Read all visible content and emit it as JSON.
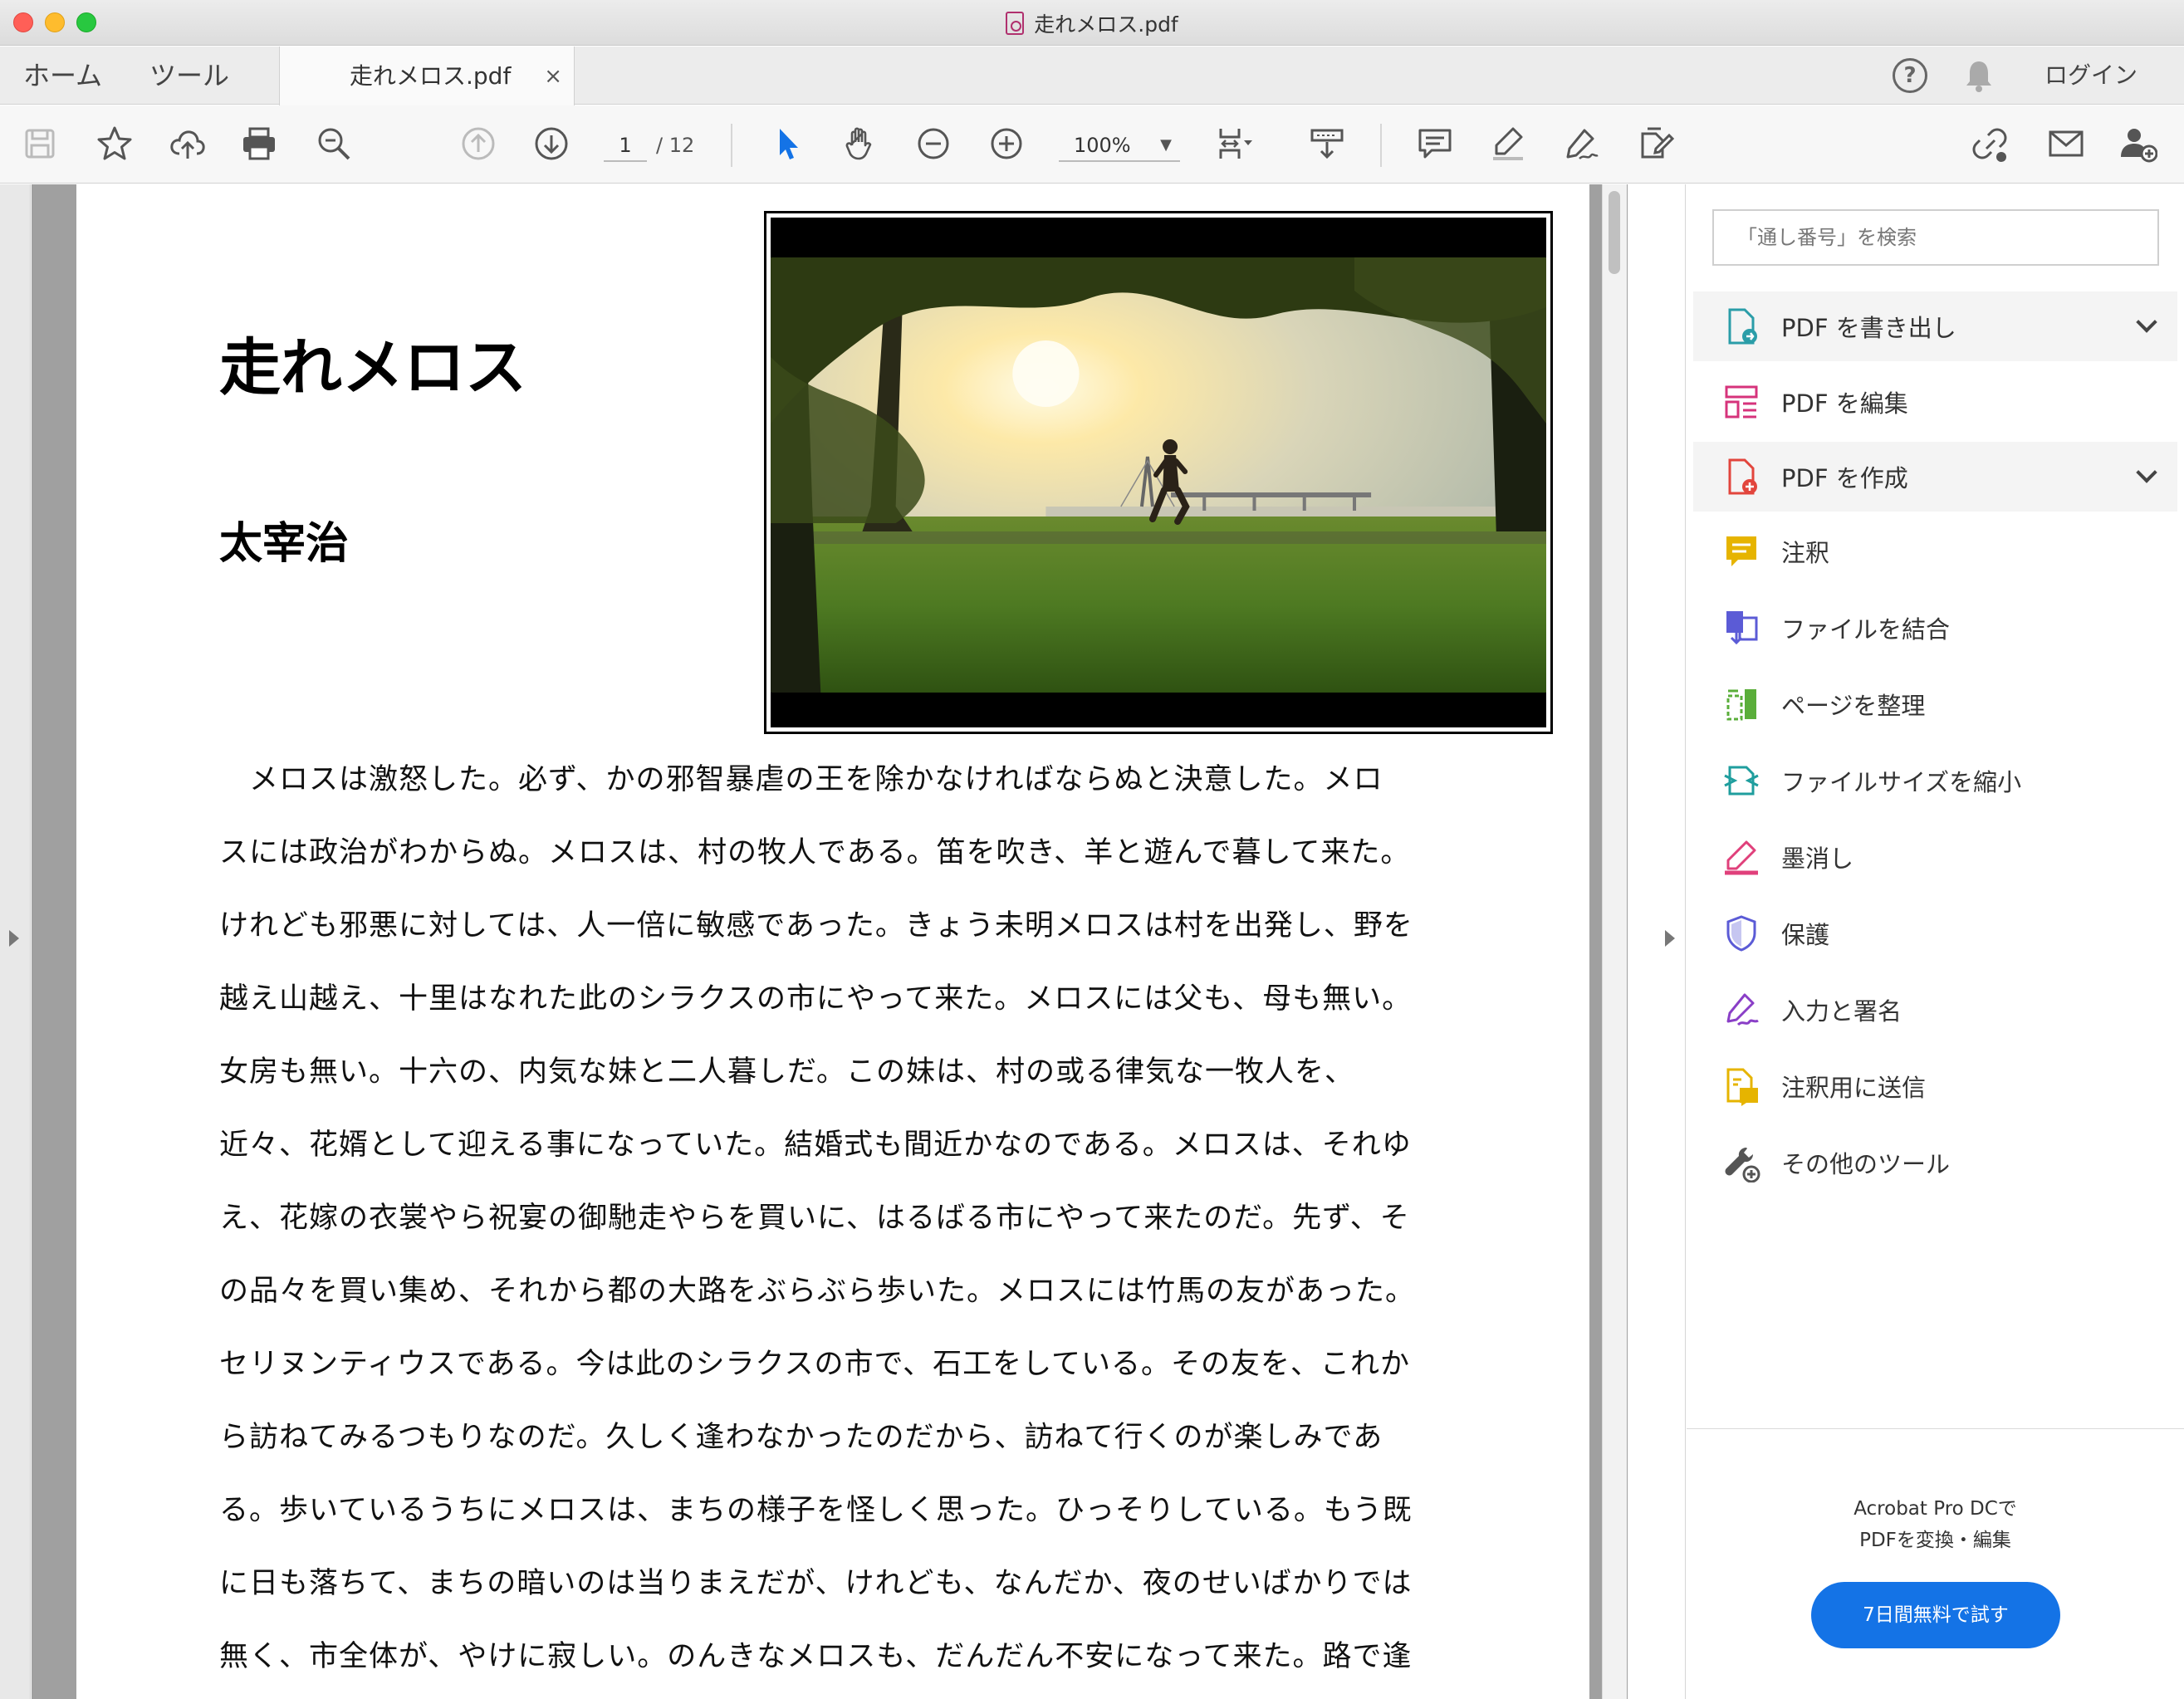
{
  "window": {
    "title": "走れメロス.pdf"
  },
  "tabs": {
    "home": "ホーム",
    "tools": "ツール",
    "document": "走れメロス.pdf",
    "close": "×"
  },
  "header": {
    "help": "?",
    "login": "ログイン"
  },
  "toolbar": {
    "current_page": "1",
    "total_pages": "/ 12",
    "zoom": "100%",
    "zoom_caret": "▼"
  },
  "document": {
    "title": "走れメロス",
    "author": "太宰治",
    "lines": [
      "　メロスは激怒した。必ず、かの邪智暴虐の王を除かなければならぬと決意した。メロ",
      "スには政治がわからぬ。メロスは、村の牧人である。笛を吹き、羊と遊んで暮して来た。",
      "けれども邪悪に対しては、人一倍に敏感であった。きょう未明メロスは村を出発し、野を",
      "越え山越え、十里はなれた此のシラクスの市にやって来た。メロスには父も、母も無い。",
      "女房も無い。十六の、内気な妹と二人暮しだ。この妹は、村の或る律気な一牧人を、",
      "近々、花婿として迎える事になっていた。結婚式も間近かなのである。メロスは、それゆ",
      "え、花嫁の衣裳やら祝宴の御馳走やらを買いに、はるばる市にやって来たのだ。先ず、そ",
      "の品々を買い集め、それから都の大路をぶらぶら歩いた。メロスには竹馬の友があった。",
      "セリヌンティウスである。今は此のシラクスの市で、石工をしている。その友を、これか",
      "ら訪ねてみるつもりなのだ。久しく逢わなかったのだから、訪ねて行くのが楽しみであ",
      "る。歩いているうちにメロスは、まちの様子を怪しく思った。ひっそりしている。もう既",
      "に日も落ちて、まちの暗いのは当りまえだが、けれども、なんだか、夜のせいばかりでは",
      "無く、市全体が、やけに寂しい。のんきなメロスも、だんだん不安になって来た。路で逢"
    ]
  },
  "panel": {
    "search_placeholder": "「通し番号」を検索",
    "items": [
      {
        "label": "PDF を書き出し",
        "icon": "export-pdf-icon",
        "color": "#2a9da8",
        "expandable": true
      },
      {
        "label": "PDF を編集",
        "icon": "edit-pdf-icon",
        "color": "#d6337b",
        "expandable": false
      },
      {
        "label": "PDF を作成",
        "icon": "create-pdf-icon",
        "color": "#e2453c",
        "expandable": true
      },
      {
        "label": "注釈",
        "icon": "comment-icon",
        "color": "#e6b400",
        "expandable": false
      },
      {
        "label": "ファイルを結合",
        "icon": "combine-files-icon",
        "color": "#5b5bd6",
        "expandable": false
      },
      {
        "label": "ページを整理",
        "icon": "organize-pages-icon",
        "color": "#5aae3a",
        "expandable": false
      },
      {
        "label": "ファイルサイズを縮小",
        "icon": "compress-icon",
        "color": "#1f9e9e",
        "expandable": false
      },
      {
        "label": "墨消し",
        "icon": "redact-icon",
        "color": "#e0407b",
        "expandable": false
      },
      {
        "label": "保護",
        "icon": "protect-icon",
        "color": "#5b5bd6",
        "expandable": false
      },
      {
        "label": "入力と署名",
        "icon": "fill-sign-icon",
        "color": "#8a3fc7",
        "expandable": false
      },
      {
        "label": "注釈用に送信",
        "icon": "send-comments-icon",
        "color": "#e6b400",
        "expandable": false
      },
      {
        "label": "その他のツール",
        "icon": "more-tools-icon",
        "color": "#555555",
        "expandable": false
      }
    ],
    "promo_line1": "Acrobat Pro DCで",
    "promo_line2": "PDFを変換・編集",
    "promo_button": "7日間無料で試す"
  },
  "colors": {
    "accent": "#1473e6",
    "select_tool": "#1473e6"
  }
}
